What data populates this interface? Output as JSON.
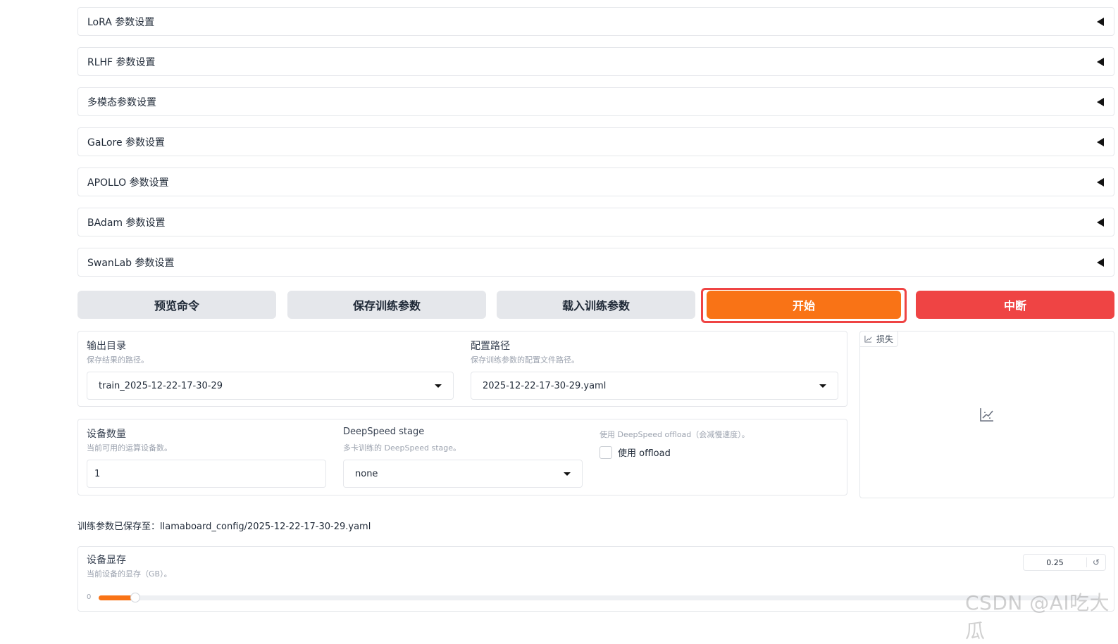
{
  "accordions": [
    {
      "title": "LoRA 参数设置"
    },
    {
      "title": "RLHF 参数设置"
    },
    {
      "title": "多模态参数设置"
    },
    {
      "title": "GaLore 参数设置"
    },
    {
      "title": "APOLLO 参数设置"
    },
    {
      "title": "BAdam 参数设置"
    },
    {
      "title": "SwanLab 参数设置"
    }
  ],
  "buttons": {
    "preview": "预览命令",
    "save": "保存训练参数",
    "load": "载入训练参数",
    "start": "开始",
    "abort": "中断"
  },
  "output_dir": {
    "label": "输出目录",
    "info": "保存结果的路径。",
    "value": "train_2025-12-22-17-30-29"
  },
  "config_path": {
    "label": "配置路径",
    "info": "保存训练参数的配置文件路径。",
    "value": "2025-12-22-17-30-29.yaml"
  },
  "device_count": {
    "label": "设备数量",
    "info": "当前可用的运算设备数。",
    "value": "1"
  },
  "ds_stage": {
    "label": "DeepSpeed stage",
    "info": "多卡训练的 DeepSpeed stage。",
    "value": "none"
  },
  "ds_offload": {
    "info": "使用 DeepSpeed offload（会减慢速度）。",
    "label": "使用 offload",
    "checked": false
  },
  "loss_plot": {
    "label": "损失"
  },
  "status_message": "训练参数已保存至：llamaboard_config/2025-12-22-17-30-29.yaml",
  "device_memory": {
    "label": "设备显存",
    "info": "当前设备的显存（GB）。",
    "value": "0.25",
    "min": "0",
    "level": 0.03
  },
  "colors": {
    "accent": "#f97316",
    "stop": "#ef4444",
    "highlight": "#ef4444"
  },
  "watermark": "CSDN @AI吃大瓜"
}
